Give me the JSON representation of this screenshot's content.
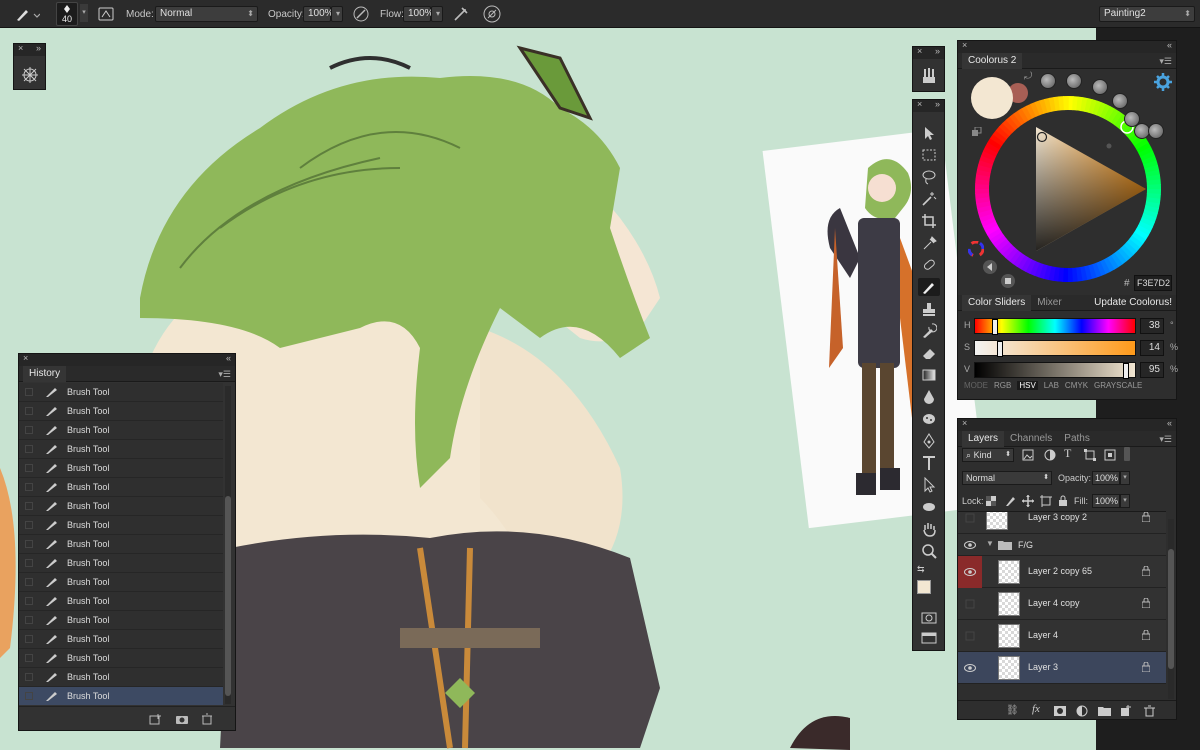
{
  "options_bar": {
    "brush_size": "40",
    "mode_label": "Mode:",
    "mode_value": "Normal",
    "opacity_label": "Opacity:",
    "opacity_value": "100%",
    "flow_label": "Flow:",
    "flow_value": "100%",
    "workspace": "Painting2"
  },
  "history": {
    "title": "History",
    "items": [
      "Brush Tool",
      "Brush Tool",
      "Brush Tool",
      "Brush Tool",
      "Brush Tool",
      "Brush Tool",
      "Brush Tool",
      "Brush Tool",
      "Brush Tool",
      "Brush Tool",
      "Brush Tool",
      "Brush Tool",
      "Brush Tool",
      "Brush Tool",
      "Brush Tool",
      "Brush Tool",
      "Brush Tool"
    ],
    "selected_index": 16
  },
  "coolorus": {
    "title": "Coolorus 2",
    "hex_hash": "#",
    "hex_value": "F3E7D2",
    "tabs": [
      "Color Sliders",
      "Mixer"
    ],
    "update_label": "Update Coolorus!",
    "sliders": [
      {
        "key": "H",
        "value": "38",
        "unit": "°",
        "level": 0.106
      },
      {
        "key": "S",
        "value": "14",
        "unit": "%",
        "level": 0.14
      },
      {
        "key": "V",
        "value": "95",
        "unit": "%",
        "level": 0.95
      }
    ],
    "modes": [
      "MODE",
      "RGB",
      "HSV",
      "LAB",
      "CMYK",
      "GRAYSCALE"
    ],
    "active_mode": "HSV",
    "fg_color": "#f3e7d2",
    "bg_color": "#a85f55"
  },
  "layers": {
    "tabs": [
      "Layers",
      "Channels",
      "Paths"
    ],
    "kind_label": "Kind",
    "blend_mode": "Normal",
    "opacity_label": "Opacity:",
    "opacity_value": "100%",
    "lock_label": "Lock:",
    "fill_label": "Fill:",
    "fill_value": "100%",
    "rows": [
      {
        "name": "Layer 3 copy 2",
        "visible": false,
        "locked": true,
        "selected": false,
        "group": false
      },
      {
        "name": "F/G",
        "visible": true,
        "locked": false,
        "selected": false,
        "group": true
      },
      {
        "name": "Layer 2 copy 65",
        "visible": true,
        "locked": true,
        "selected": false,
        "group": false,
        "highlight": true
      },
      {
        "name": "Layer 4 copy",
        "visible": false,
        "locked": true,
        "selected": false,
        "group": false
      },
      {
        "name": "Layer 4",
        "visible": false,
        "locked": true,
        "selected": false,
        "group": false
      },
      {
        "name": "Layer 3",
        "visible": true,
        "locked": true,
        "selected": true,
        "group": false
      }
    ]
  },
  "colors": {
    "canvas_bg": "#c8e3d1",
    "panel_bg": "#323232",
    "selection": "#3c465c",
    "accent_blue": "#4aa3df",
    "hair_green": "#8fb85a"
  }
}
